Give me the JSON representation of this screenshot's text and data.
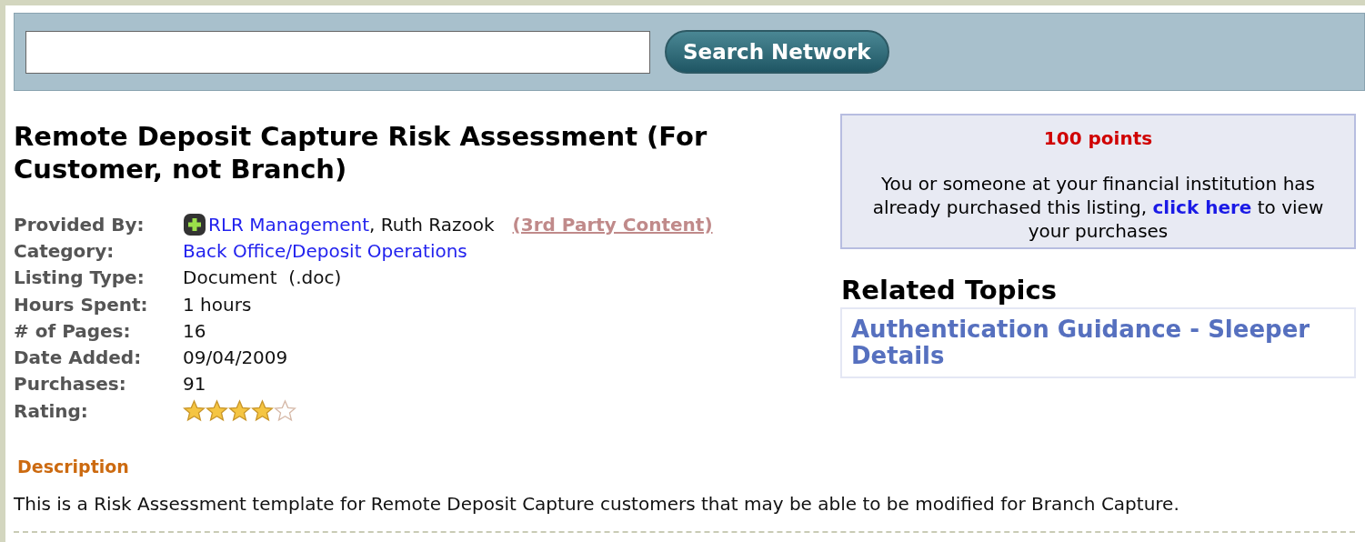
{
  "search": {
    "button": "Search Network"
  },
  "listing": {
    "title": "Remote Deposit Capture Risk Assessment (For Customer, not Branch)",
    "details": [
      {
        "kind": "provider",
        "label": "Provided By:",
        "link": "RLR Management",
        "text": ", Ruth Razook",
        "tag": "(3rd Party Content)"
      },
      {
        "kind": "link",
        "label": "Category:",
        "value": "Back Office/Deposit Operations"
      },
      {
        "kind": "text",
        "label": "Listing Type:",
        "value": "Document  (.doc)"
      },
      {
        "kind": "text",
        "label": "Hours Spent:",
        "value": "1 hours"
      },
      {
        "kind": "text",
        "label": "# of Pages:",
        "value": "16"
      },
      {
        "kind": "text",
        "label": "Date Added:",
        "value": "09/04/2009"
      },
      {
        "kind": "text",
        "label": "Purchases:",
        "value": "91"
      },
      {
        "kind": "rating",
        "label": "Rating:",
        "stars": 4
      }
    ],
    "description_heading": "Description",
    "description": "This is a Risk Assessment template for Remote Deposit Capture customers that may be able to be modified for Branch Capture."
  },
  "points_box": {
    "points": "100 points",
    "before": "You or someone at your financial institution has already purchased this listing, ",
    "link": "click here",
    "after": " to view your purchases"
  },
  "related_topics": {
    "heading": "Related Topics",
    "items": [
      "Authentication Guidance - Sleeper Details"
    ]
  }
}
